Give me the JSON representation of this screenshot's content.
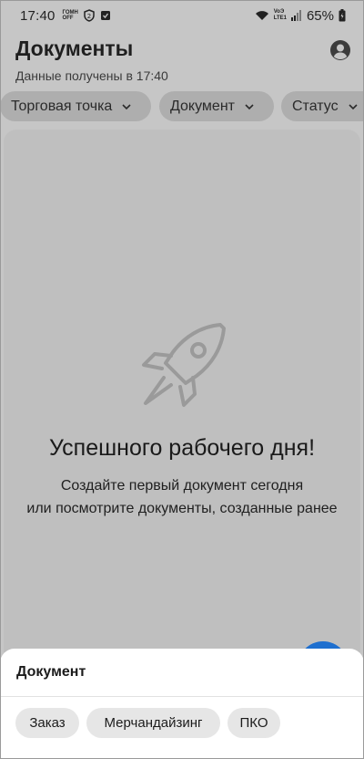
{
  "status_bar": {
    "time": "17:40",
    "mini_label_line1": "ГОМН",
    "mini_label_line2": "OFF",
    "volte_line1": "VoЭ",
    "volte_line2": "LTE1",
    "battery": "65%"
  },
  "header": {
    "title": "Документы",
    "subtitle": "Данные получены в 17:40"
  },
  "filters": [
    {
      "label": "Торговая точка"
    },
    {
      "label": "Документ"
    },
    {
      "label": "Статус"
    }
  ],
  "empty_state": {
    "title": "Успешного рабочего дня!",
    "line1": "Создайте первый документ сегодня",
    "line2": "или посмотрите документы, созданные ранее"
  },
  "sheet": {
    "title": "Документ",
    "options": [
      {
        "label": "Заказ"
      },
      {
        "label": "Мерчандайзинг"
      },
      {
        "label": "ПКО"
      }
    ]
  },
  "colors": {
    "scrim_background": "#c6c6c6",
    "fab": "#1e6fcf",
    "sheet_background": "#ffffff"
  }
}
